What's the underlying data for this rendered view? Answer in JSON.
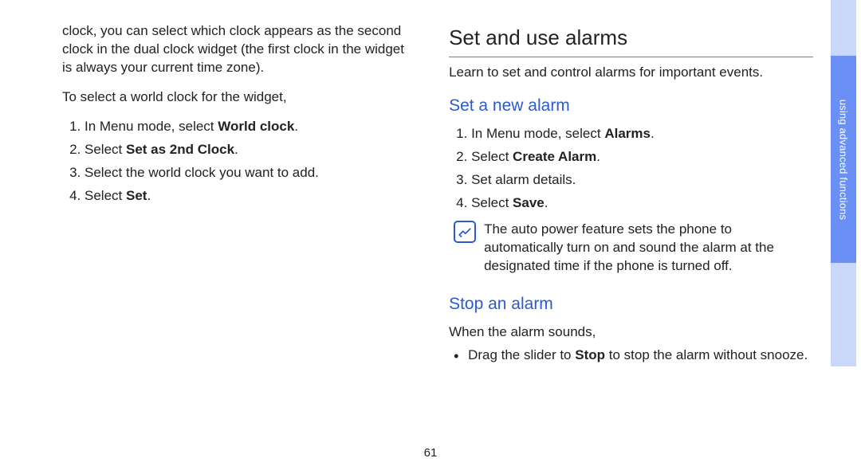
{
  "pageNumber": "61",
  "sideTabLabel": "using advanced functions",
  "left": {
    "intro": "clock, you can select which clock appears as the second clock in the dual clock widget (the first clock in the widget is always your current time zone).",
    "lead": "To select a world clock for the widget,",
    "steps": [
      {
        "pre": "In Menu mode, select ",
        "bold": "World clock",
        "post": "."
      },
      {
        "pre": "Select ",
        "bold": "Set as 2nd Clock",
        "post": "."
      },
      {
        "pre": "Select the world clock you want to add.",
        "bold": "",
        "post": ""
      },
      {
        "pre": "Select ",
        "bold": "Set",
        "post": "."
      }
    ]
  },
  "right": {
    "title": "Set and use alarms",
    "intro": "Learn to set and control alarms for important events.",
    "setNew": {
      "heading": "Set a new alarm",
      "steps": [
        {
          "pre": "In Menu mode, select ",
          "bold": "Alarms",
          "post": "."
        },
        {
          "pre": "Select ",
          "bold": "Create Alarm",
          "post": "."
        },
        {
          "pre": "Set alarm details.",
          "bold": "",
          "post": ""
        },
        {
          "pre": "Select ",
          "bold": "Save",
          "post": "."
        }
      ],
      "note": "The auto power feature sets the phone to automatically turn on and sound the alarm at the designated time if the phone is turned off."
    },
    "stop": {
      "heading": "Stop an alarm",
      "lead": "When the alarm sounds,",
      "bullets": [
        {
          "pre": "Drag the slider to ",
          "bold": "Stop",
          "post": " to stop the alarm without snooze."
        }
      ]
    }
  }
}
